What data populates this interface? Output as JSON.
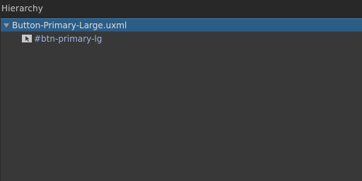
{
  "panel": {
    "title": "Hierarchy"
  },
  "tree": {
    "root": {
      "label": "Button-Primary-Large.uxml",
      "expanded": true,
      "selected": true,
      "icon": "triangle-down-icon"
    },
    "children": [
      {
        "label": "#btn-primary-lg",
        "icon": "visual-element-icon"
      }
    ]
  },
  "colors": {
    "background": "#383838",
    "header_background": "#282828",
    "selection": "#2c5d87",
    "selector_text": "#9fb2e6"
  }
}
